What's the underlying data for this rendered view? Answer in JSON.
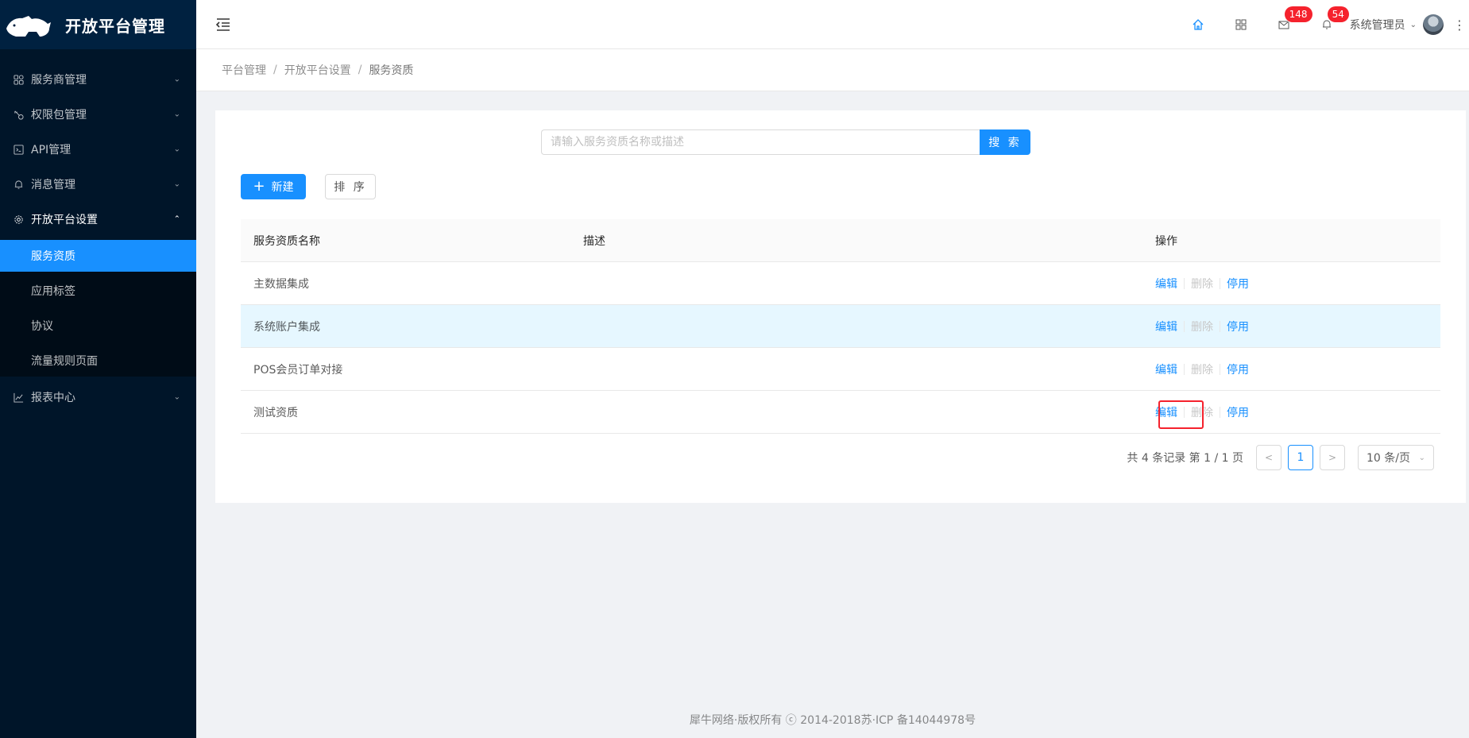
{
  "app": {
    "title": "开放平台管理"
  },
  "sidebar": {
    "items": [
      {
        "label": "服务商管理",
        "icon": "grid-icon",
        "arrow": "chevron-down"
      },
      {
        "label": "权限包管理",
        "icon": "key-icon",
        "arrow": "chevron-down"
      },
      {
        "label": "API管理",
        "icon": "code-icon",
        "arrow": "chevron-down"
      },
      {
        "label": "消息管理",
        "icon": "bell-icon",
        "arrow": "chevron-down"
      },
      {
        "label": "开放平台设置",
        "icon": "gear-icon",
        "arrow": "chevron-up"
      },
      {
        "label": "报表中心",
        "icon": "line-chart-icon",
        "arrow": "chevron-down"
      }
    ],
    "submenu": [
      {
        "label": "服务资质",
        "active": true
      },
      {
        "label": "应用标签"
      },
      {
        "label": "协议"
      },
      {
        "label": "流量规则页面"
      }
    ]
  },
  "header": {
    "mail_badge": "148",
    "bell_badge": "54",
    "user_name": "系统管理员"
  },
  "breadcrumb": [
    "平台管理",
    "开放平台设置",
    "服务资质"
  ],
  "search": {
    "placeholder": "请输入服务资质名称或描述",
    "value": "",
    "button": "搜 索"
  },
  "toolbar": {
    "new_label": "新建",
    "sort_label": "排 序"
  },
  "table": {
    "columns": [
      "服务资质名称",
      "描述",
      "操作"
    ],
    "rows": [
      {
        "name": "主数据集成",
        "desc": ""
      },
      {
        "name": "系统账户集成",
        "desc": ""
      },
      {
        "name": "POS会员订单对接",
        "desc": ""
      },
      {
        "name": "测试资质",
        "desc": ""
      }
    ],
    "actions": {
      "edit": "编辑",
      "delete": "删除",
      "disable": "停用"
    }
  },
  "pagination": {
    "total_text": "共 4 条记录 第 1 / 1 页",
    "current": "1",
    "page_size": "10 条/页"
  },
  "footer": {
    "text": "犀牛网络·版权所有 ⓒ 2014-2018苏·ICP 备14044978号"
  },
  "colors": {
    "primary": "#1890ff",
    "sidebar_bg": "#001529",
    "badge": "#f5222d"
  }
}
